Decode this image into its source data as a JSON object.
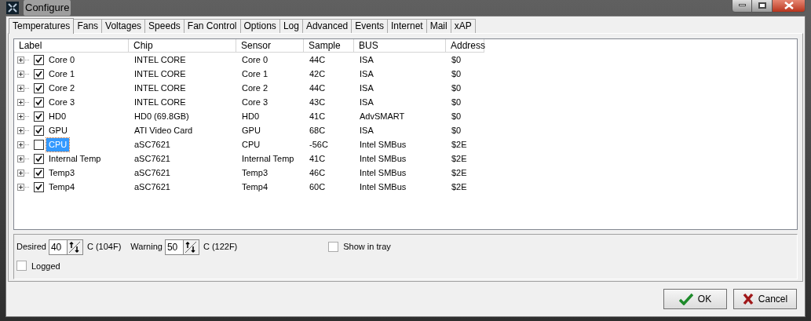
{
  "window": {
    "title": "Configure"
  },
  "tabs": [
    {
      "label": "Temperatures",
      "selected": true
    },
    {
      "label": "Fans",
      "selected": false
    },
    {
      "label": "Voltages",
      "selected": false
    },
    {
      "label": "Speeds",
      "selected": false
    },
    {
      "label": "Fan Control",
      "selected": false
    },
    {
      "label": "Options",
      "selected": false
    },
    {
      "label": "Log",
      "selected": false
    },
    {
      "label": "Advanced",
      "selected": false
    },
    {
      "label": "Events",
      "selected": false
    },
    {
      "label": "Internet",
      "selected": false
    },
    {
      "label": "Mail",
      "selected": false
    },
    {
      "label": "xAP",
      "selected": false
    }
  ],
  "table": {
    "columns": [
      "Label",
      "Chip",
      "Sensor",
      "Sample",
      "BUS",
      "Address"
    ],
    "rows": [
      {
        "cells": [
          "Core 0",
          "INTEL CORE",
          "Core 0",
          "44C",
          "ISA",
          "$0"
        ],
        "checked": true,
        "selected": false
      },
      {
        "cells": [
          "Core 1",
          "INTEL CORE",
          "Core 1",
          "42C",
          "ISA",
          "$0"
        ],
        "checked": true,
        "selected": false
      },
      {
        "cells": [
          "Core 2",
          "INTEL CORE",
          "Core 2",
          "44C",
          "ISA",
          "$0"
        ],
        "checked": true,
        "selected": false
      },
      {
        "cells": [
          "Core 3",
          "INTEL CORE",
          "Core 3",
          "43C",
          "ISA",
          "$0"
        ],
        "checked": true,
        "selected": false
      },
      {
        "cells": [
          "HD0",
          "HD0 (69.8GB)",
          "HD0",
          "41C",
          "AdvSMART",
          "$0"
        ],
        "checked": true,
        "selected": false
      },
      {
        "cells": [
          "GPU",
          "ATI Video Card",
          "GPU",
          "68C",
          "ISA",
          "$0"
        ],
        "checked": true,
        "selected": false
      },
      {
        "cells": [
          "CPU",
          "aSC7621",
          "CPU",
          "-56C",
          "Intel SMBus",
          "$2E"
        ],
        "checked": false,
        "selected": true
      },
      {
        "cells": [
          "Internal Temp",
          "aSC7621",
          "Internal Temp",
          "41C",
          "Intel SMBus",
          "$2E"
        ],
        "checked": true,
        "selected": false
      },
      {
        "cells": [
          "Temp3",
          "aSC7621",
          "Temp3",
          "46C",
          "Intel SMBus",
          "$2E"
        ],
        "checked": true,
        "selected": false
      },
      {
        "cells": [
          "Temp4",
          "aSC7621",
          "Temp4",
          "60C",
          "Intel SMBus",
          "$2E"
        ],
        "checked": true,
        "selected": false
      }
    ]
  },
  "options": {
    "desired": {
      "label": "Desired",
      "value": "40",
      "unit": "C (104F)"
    },
    "warning": {
      "label": "Warning",
      "value": "50",
      "unit": "C (122F)"
    },
    "show_in_tray": {
      "label": "Show in tray",
      "checked": false
    },
    "logged": {
      "label": "Logged",
      "checked": false
    }
  },
  "buttons": [
    {
      "label": "OK",
      "kind": "ok"
    },
    {
      "label": "Cancel",
      "kind": "cancel"
    }
  ]
}
